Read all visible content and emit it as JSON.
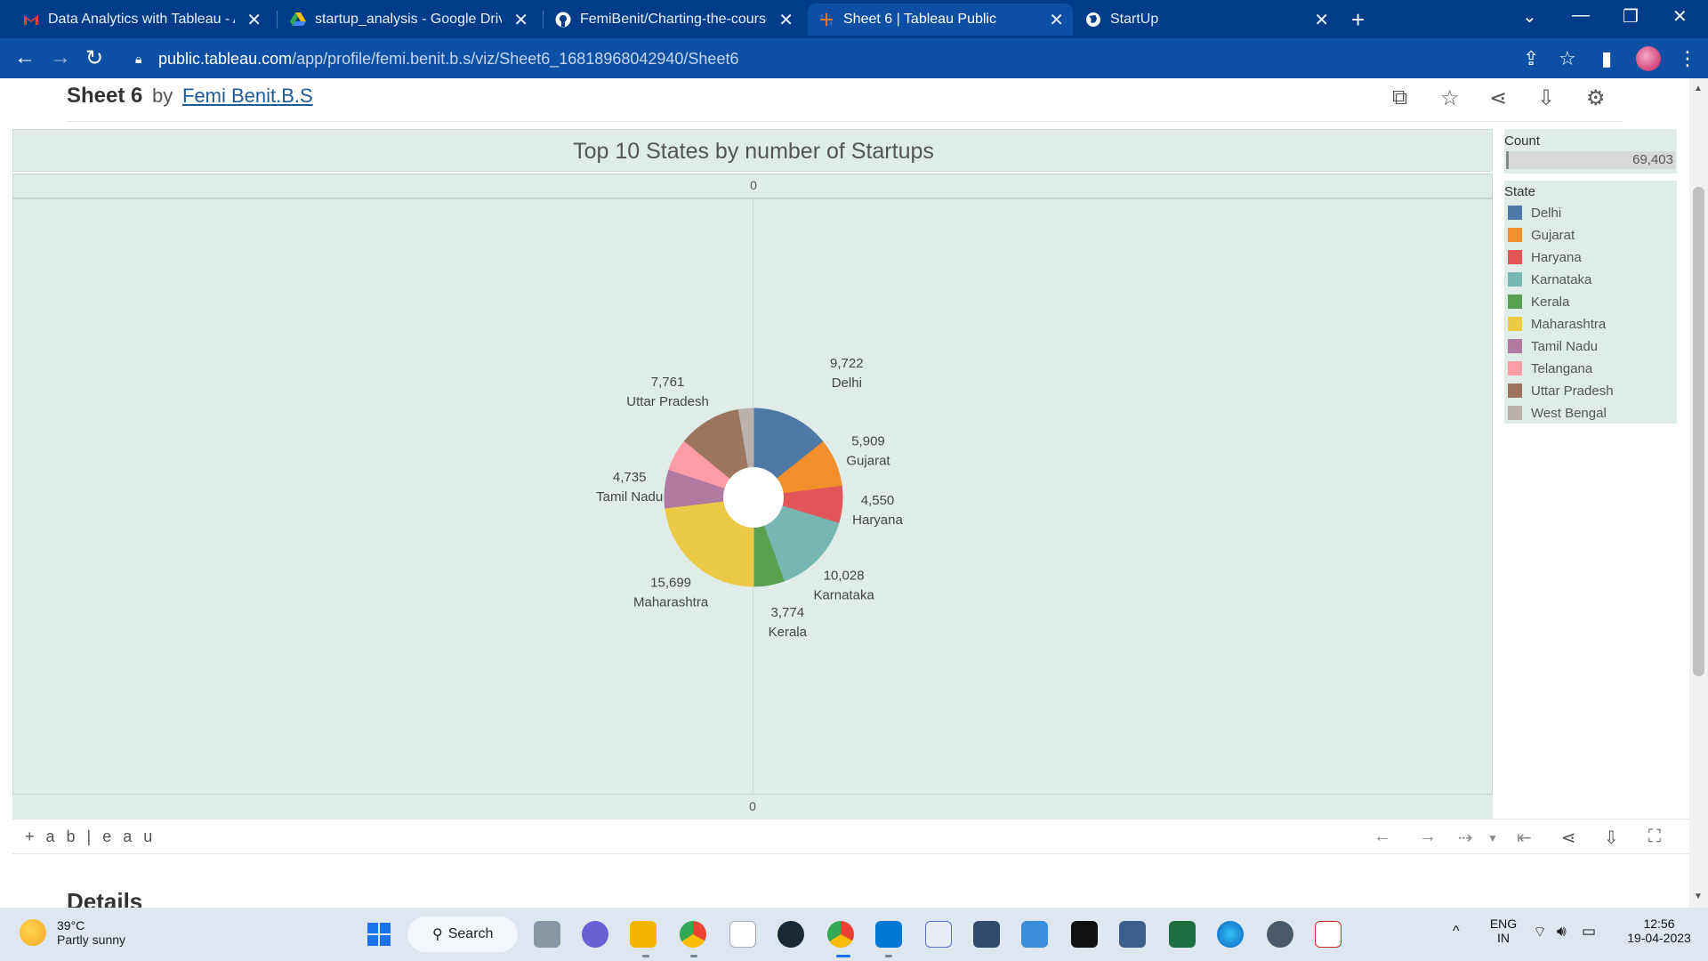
{
  "browser": {
    "tabs": [
      {
        "title": "Data Analytics with Tableau - AM",
        "icon": "gmail-icon",
        "active": false
      },
      {
        "title": "startup_analysis - Google Drive",
        "icon": "google-drive-icon",
        "active": false
      },
      {
        "title": "FemiBenit/Charting-the-course-o",
        "icon": "github-icon",
        "active": false
      },
      {
        "title": "Sheet 6 | Tableau Public",
        "icon": "tableau-icon",
        "active": true
      },
      {
        "title": "StartUp",
        "icon": "globe-icon",
        "active": false
      }
    ],
    "url_host": "public.tableau.com",
    "url_path": "/app/profile/femi.benit.b.s/viz/Sheet6_16818968042940/Sheet6"
  },
  "viz": {
    "sheet_name": "Sheet 6",
    "by_label": "by",
    "author": "Femi Benit.B.S",
    "details_heading": "Details",
    "tableau_logo": "+ a b | e a u",
    "axis_top_label": "0",
    "axis_bottom_label": "0"
  },
  "legend": {
    "count_title": "Count",
    "count_value": "69,403",
    "state_title": "State"
  },
  "chart_data": {
    "type": "pie",
    "title": "Top 10 States by number of Startups",
    "slices": [
      {
        "label": "Delhi",
        "value": 9722,
        "display": "9,722",
        "color": "#4e79a7"
      },
      {
        "label": "Gujarat",
        "value": 5909,
        "display": "5,909",
        "color": "#f28e2b"
      },
      {
        "label": "Haryana",
        "value": 4550,
        "display": "4,550",
        "color": "#e15759"
      },
      {
        "label": "Karnataka",
        "value": 10028,
        "display": "10,028",
        "color": "#76b7b2"
      },
      {
        "label": "Kerala",
        "value": 3774,
        "display": "3,774",
        "color": "#59a14f"
      },
      {
        "label": "Maharashtra",
        "value": 15699,
        "display": "15,699",
        "color": "#edc948"
      },
      {
        "label": "Tamil Nadu",
        "value": 4735,
        "display": "4,735",
        "color": "#b07aa1"
      },
      {
        "label": "Telangana",
        "value": 3966,
        "display": "",
        "color": "#ff9da7"
      },
      {
        "label": "Uttar Pradesh",
        "value": 7761,
        "display": "7,761",
        "color": "#9c755f"
      },
      {
        "label": "West Bengal",
        "value": 1823,
        "display": "",
        "color": "#bab0ac"
      }
    ],
    "legend_placement": "right"
  },
  "taskbar": {
    "weather_temp": "39°C",
    "weather_cond": "Partly sunny",
    "search_label": "Search",
    "lang_top": "ENG",
    "lang_bottom": "IN",
    "time": "12:56",
    "date": "19-04-2023"
  }
}
